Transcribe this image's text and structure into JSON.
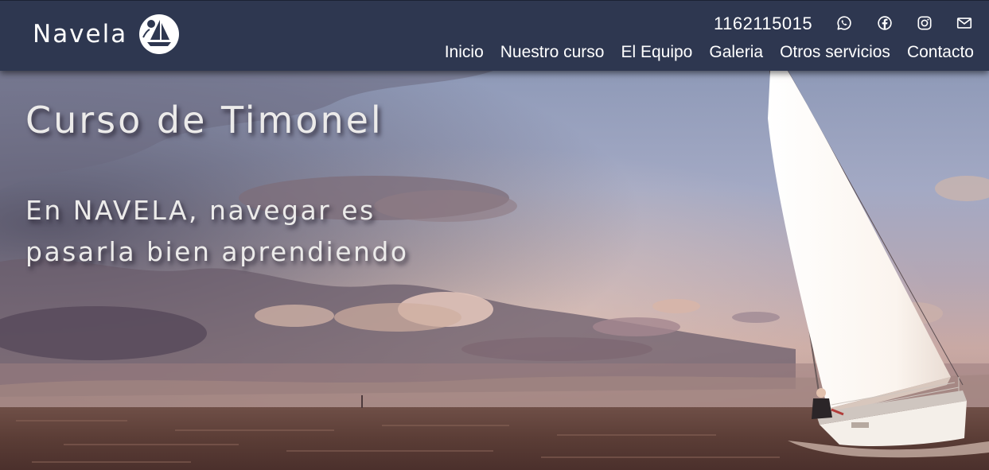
{
  "header": {
    "brand_name": "Navela",
    "logo_icon": "sailboat-in-circle-logo",
    "phone": "1162115015",
    "social_icons": [
      "whatsapp-icon",
      "facebook-icon",
      "instagram-icon",
      "mail-icon"
    ]
  },
  "nav": {
    "items": [
      {
        "label": "Inicio"
      },
      {
        "label": "Nuestro curso"
      },
      {
        "label": "El Equipo"
      },
      {
        "label": "Galeria"
      },
      {
        "label": "Otros servicios"
      },
      {
        "label": "Contacto"
      }
    ]
  },
  "hero": {
    "title": "Curso de Timonel",
    "subtitle": "En NAVELA, navegar es pasarla bien aprendiendo",
    "background": "sailboat-at-sunset-photo"
  },
  "colors": {
    "header_bg": "#2e3750",
    "text": "#ffffff",
    "hero_text": "#ecebea"
  }
}
